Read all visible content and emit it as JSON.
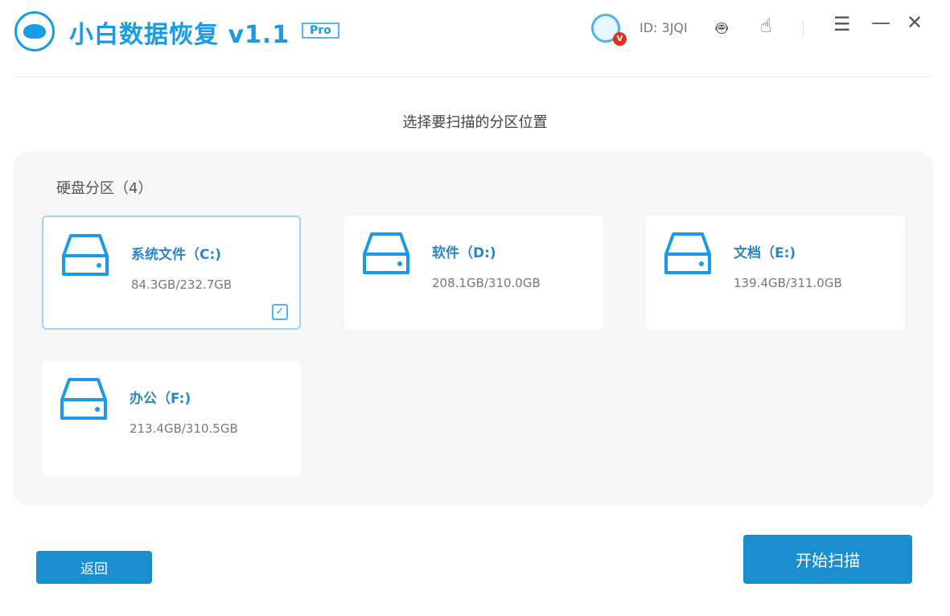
{
  "app": {
    "title": "小白数据恢复 v1.1",
    "badge": "Pro",
    "user_id": "ID: 3JQI",
    "vip": "V"
  },
  "icons": [
    "robot-icon",
    "hand-tap-icon",
    "menu-icon",
    "minimize-icon",
    "close-icon"
  ],
  "subtitle": "选择要扫描的分区位置",
  "group_label": "硬盘分区（4）",
  "drives": [
    {
      "name": "系统文件（C:)",
      "size": "84.3GB/232.7GB",
      "selected": true
    },
    {
      "name": "软件（D:)",
      "size": "208.1GB/310.0GB",
      "selected": false
    },
    {
      "name": "文档（E:)",
      "size": "139.4GB/311.0GB",
      "selected": false
    },
    {
      "name": "办公（F:)",
      "size": "213.4GB/310.5GB",
      "selected": false
    }
  ],
  "buttons": {
    "back": "返回",
    "start": "开始扫描"
  },
  "colors": {
    "accent": "#1a9be6",
    "button": "#1a8fd0"
  }
}
